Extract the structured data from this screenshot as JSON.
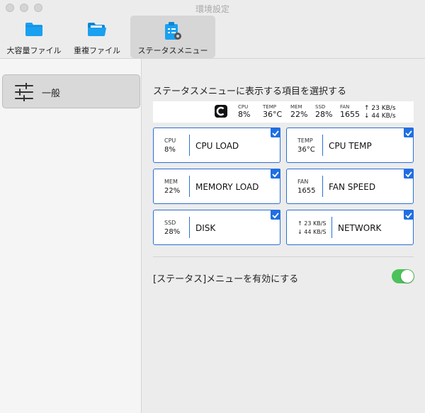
{
  "window": {
    "title": "環境設定"
  },
  "toolbar": {
    "items": [
      {
        "label": "大容量ファイル",
        "icon": "folder-icon"
      },
      {
        "label": "重複ファイル",
        "icon": "open-folder-icon"
      },
      {
        "label": "ステータスメニュー",
        "icon": "clipboard-gear-icon",
        "selected": true
      }
    ]
  },
  "sidebar": {
    "items": [
      {
        "label": "一般",
        "icon": "sliders-icon",
        "selected": true
      }
    ]
  },
  "main": {
    "heading": "ステータスメニューに表示する項目を選択する",
    "preview": {
      "cpu": {
        "label": "CPU",
        "value": "8%"
      },
      "temp": {
        "label": "TEMP",
        "value": "36°C"
      },
      "mem": {
        "label": "MEM",
        "value": "22%"
      },
      "ssd": {
        "label": "SSD",
        "value": "28%"
      },
      "fan": {
        "label": "FAN",
        "value": "1655"
      },
      "net_up": "↑ 23 KB/s",
      "net_down": "↓ 44 KB/s"
    },
    "cards": [
      {
        "small": "CPU",
        "value": "8%",
        "label": "CPU LOAD",
        "checked": true
      },
      {
        "small": "TEMP",
        "value": "36°C",
        "label": "CPU TEMP",
        "checked": true
      },
      {
        "small": "MEM",
        "value": "22%",
        "label": "MEMORY LOAD",
        "checked": true
      },
      {
        "small": "FAN",
        "value": "1655",
        "label": "FAN SPEED",
        "checked": true
      },
      {
        "small": "SSD",
        "value": "28%",
        "label": "DISK",
        "checked": true
      },
      {
        "up": "↑ 23 KB/S",
        "down": "↓ 44 KB/S",
        "label": "NETWORK",
        "checked": true
      }
    ],
    "enable_label": "[ステータス]メニューを有効にする",
    "enable_on": true
  },
  "colors": {
    "accent": "#1f6fe3",
    "toggle_on": "#4cc25a",
    "folder": "#1aa0f0"
  }
}
